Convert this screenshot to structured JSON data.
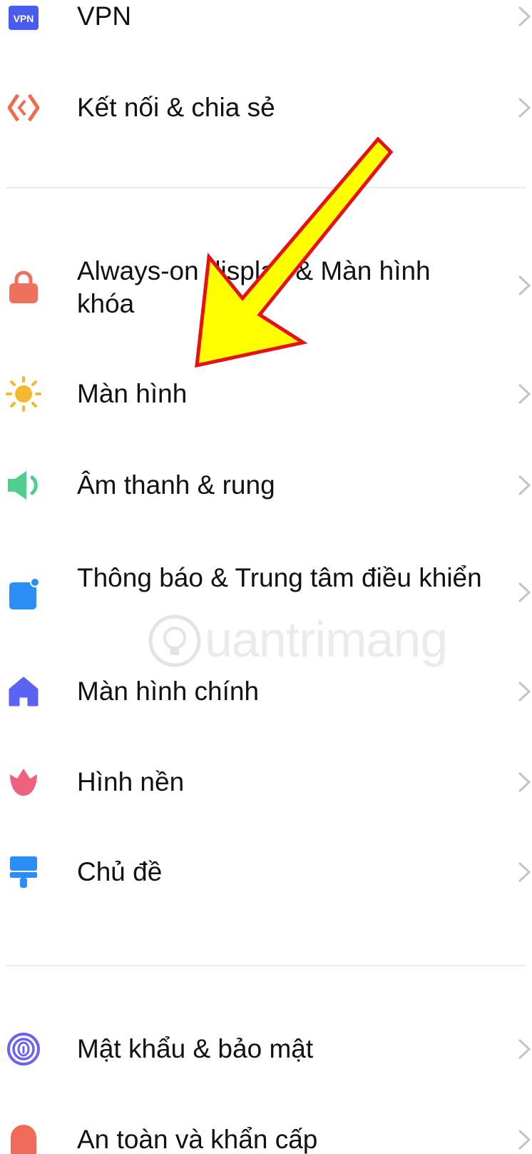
{
  "settings": {
    "items": [
      {
        "label": "VPN",
        "icon": "vpn-icon"
      },
      {
        "label": "Kết nối & chia sẻ",
        "icon": "connection-share-icon"
      },
      {
        "label": "Always-on display & Màn hình khóa",
        "icon": "lock-icon"
      },
      {
        "label": "Màn hình",
        "icon": "sun-icon"
      },
      {
        "label": "Âm thanh & rung",
        "icon": "speaker-icon"
      },
      {
        "label": "Thông báo & Trung tâm điều khiển",
        "icon": "notification-icon"
      },
      {
        "label": "Màn hình chính",
        "icon": "home-icon"
      },
      {
        "label": "Hình nền",
        "icon": "flower-icon"
      },
      {
        "label": "Chủ đề",
        "icon": "brush-icon"
      },
      {
        "label": "Mật khẩu & bảo mật",
        "icon": "fingerprint-icon"
      },
      {
        "label": "An toàn và khẩn cấp",
        "icon": "emergency-icon"
      }
    ]
  },
  "vpn_badge": "VPN",
  "watermark": "uantrimang",
  "colors": {
    "vpn": "#4a5cf0",
    "connection": "#f26b4c",
    "lock": "#f0705e",
    "sun": "#f6b730",
    "speaker": "#4fcf8e",
    "notification": "#2a8ef5",
    "home": "#5a63f2",
    "flower": "#f0607f",
    "brush": "#2a8ef5",
    "fingerprint": "#6b63f0",
    "emergency": "#f06a5a",
    "arrow_fill": "#ffff00",
    "arrow_stroke": "#e81010"
  }
}
